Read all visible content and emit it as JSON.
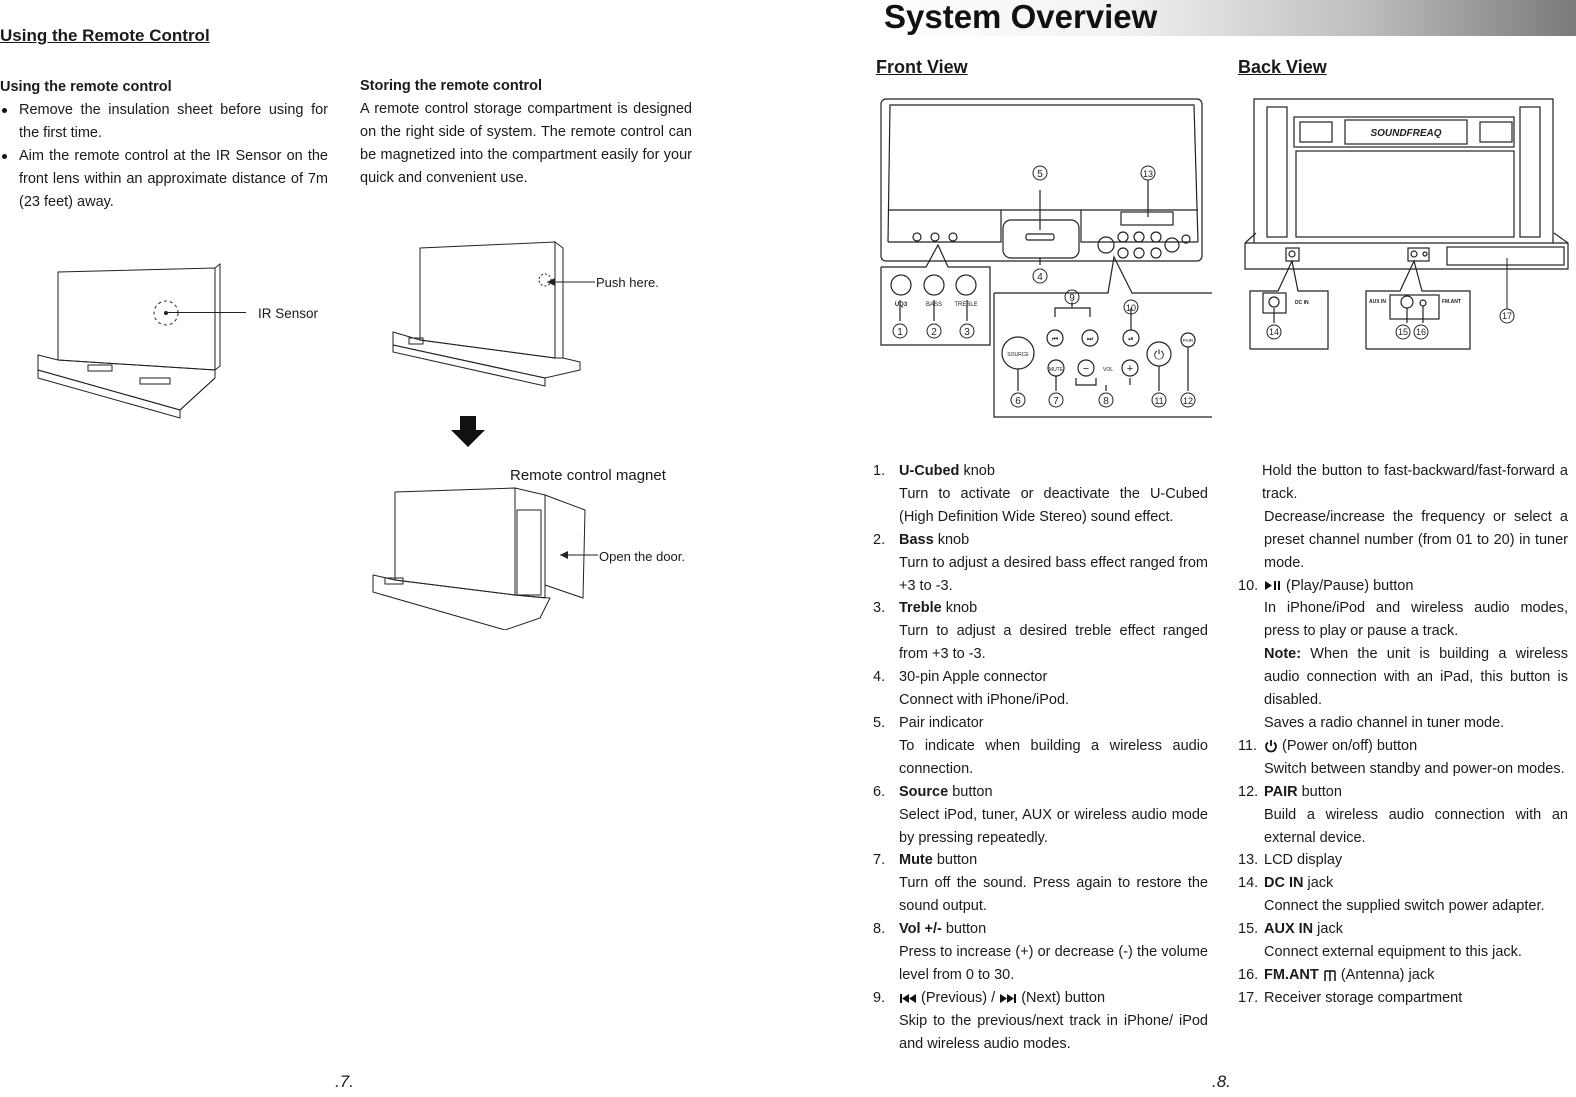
{
  "left_page": {
    "title": "Using the Remote Control",
    "using": {
      "heading": "Using the remote control",
      "bullets": [
        "Remove the insulation sheet before using for the first time.",
        "Aim the remote control at the IR Sensor on the front lens within an approximate distance of 7m (23 feet) away."
      ],
      "ir_label": "IR Sensor"
    },
    "storing": {
      "heading": "Storing the remote control",
      "text": "A remote control storage compartment is designed on the right side of system. The remote control can be magnetized into the compartment easily for your quick and convenient use.",
      "push_label": "Push here.",
      "magnet_label": "Remote control magnet",
      "door_label": "Open the door."
    },
    "page_number": ".7."
  },
  "right_page": {
    "title": "System Overview",
    "front_view": {
      "title": "Front View",
      "knob_labels": [
        "UQ3",
        "BASS",
        "TREBLE"
      ],
      "button_labels": {
        "source": "SOURCE",
        "mute": "MUTE",
        "vol": "VOL",
        "pair": "PAIR"
      },
      "callouts": [
        "1",
        "2",
        "3",
        "4",
        "5",
        "6",
        "7",
        "8",
        "9",
        "10",
        "11",
        "12",
        "13"
      ]
    },
    "back_view": {
      "title": "Back View",
      "brand": "SOUNDFREAQ",
      "labels": {
        "dc_in": "DC IN",
        "aux_in": "AUX IN",
        "fm_ant": "FM.ANT"
      },
      "callouts": [
        "14",
        "15",
        "16",
        "17"
      ]
    },
    "items_col1": [
      {
        "num": "1.",
        "bold": "U-Cubed",
        "rest": " knob",
        "desc": [
          "Turn to activate or deactivate the U-Cubed (High Definition Wide Stereo) sound effect."
        ]
      },
      {
        "num": "2.",
        "bold": "Bass",
        "rest": " knob",
        "desc": [
          "Turn to adjust a desired bass effect ranged from +3 to -3."
        ]
      },
      {
        "num": "3.",
        "bold": "Treble",
        "rest": "  knob",
        "desc": [
          "Turn to adjust a desired treble effect ranged from +3 to -3."
        ]
      },
      {
        "num": "4.",
        "bold": "",
        "rest": "30-pin Apple connector",
        "desc": [
          "Connect with iPhone/iPod."
        ]
      },
      {
        "num": "5.",
        "bold": "",
        "rest": "Pair indicator",
        "desc": [
          "To indicate when building a wireless audio connection."
        ]
      },
      {
        "num": "6.",
        "bold": "Source",
        "rest": " button",
        "desc": [
          "Select iPod, tuner, AUX or wireless audio mode by pressing repeatedly."
        ]
      },
      {
        "num": "7.",
        "bold": "Mute",
        "rest": " button",
        "desc": [
          "Turn off the sound. Press again to restore the sound output."
        ]
      },
      {
        "num": "8.",
        "bold": "Vol +/-",
        "rest": " button",
        "desc": [
          "Press to increase (+) or decrease (-) the volume level from 0 to 30."
        ]
      }
    ],
    "item9": {
      "num": "9.",
      "icon_prev": "previous-track-icon",
      "prev_text": " (Previous) / ",
      "icon_next": "next-track-icon",
      "next_text": " (Next) button",
      "desc": "Skip to the previous/next track in iPhone/ iPod and wireless audio modes."
    },
    "col2_continuation": [
      "Hold the button to fast-backward/fast-forward a track.",
      "Decrease/increase the frequency or select a preset channel number (from 01 to 20) in tuner mode."
    ],
    "item10": {
      "num": "10.",
      "icon": "play-pause-icon",
      "text": "  (Play/Pause) button",
      "desc": "In iPhone/iPod and wireless audio modes, press to play or pause a track.",
      "note_bold": "Note:",
      "note": " When the unit is building a wireless audio connection with an iPad, this button is disabled.",
      "extra": "Saves a radio channel in tuner mode."
    },
    "item11": {
      "num": "11.",
      "icon": "power-icon",
      "text": "  (Power on/off) button",
      "desc": "Switch between standby and power-on modes."
    },
    "items_col2": [
      {
        "num": "12.",
        "bold": "PAIR",
        "rest": " button",
        "desc": [
          "Build a wireless audio connection with an external device."
        ]
      },
      {
        "num": "13.",
        "bold": "",
        "rest": "LCD display",
        "desc": []
      },
      {
        "num": "14.",
        "bold": "DC IN",
        "rest": " jack",
        "desc": [
          "Connect the supplied switch power adapter."
        ]
      },
      {
        "num": "15.",
        "bold": "AUX IN",
        "rest": " jack",
        "desc": [
          "Connect external equipment to this jack."
        ]
      }
    ],
    "item16": {
      "num": "16.",
      "bold": "FM.ANT",
      "icon": "antenna-icon",
      "rest": " (Antenna) jack"
    },
    "item17": {
      "num": "17.",
      "rest": "Receiver storage compartment"
    },
    "page_number": ".8."
  }
}
